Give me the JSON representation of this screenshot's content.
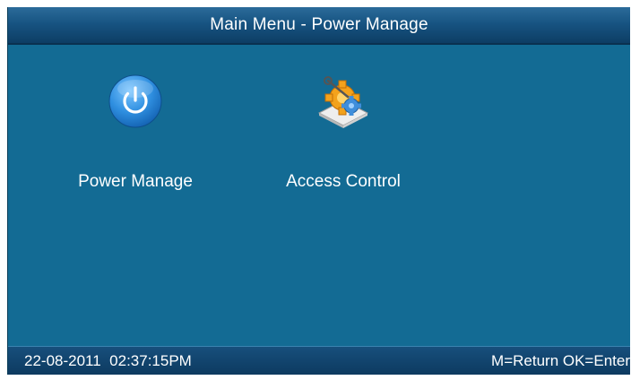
{
  "title_bar": {
    "title": "Main Menu - Power Manage"
  },
  "menu": {
    "items": [
      {
        "label": "Power Manage",
        "icon": "power-icon",
        "selected": true
      },
      {
        "label": "Access Control",
        "icon": "gear-puzzle-icon",
        "selected": false
      }
    ]
  },
  "status_bar": {
    "date": "22-08-2011",
    "time": "02:37:15PM",
    "hint": "M=Return OK=Enter"
  },
  "colors": {
    "background": "#136b94",
    "bars": "#0d3d64",
    "power_icon": "#2f8fe0",
    "text": "#ffffff"
  }
}
